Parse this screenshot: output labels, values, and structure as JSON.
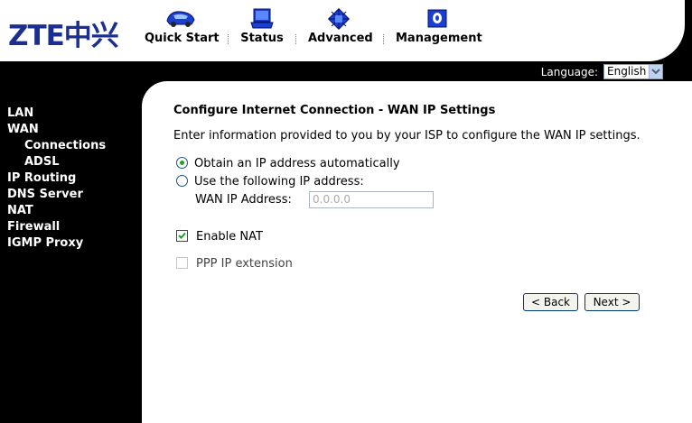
{
  "brand": {
    "logo": "ZTE中兴",
    "color": "#1a2f8f"
  },
  "nav": [
    {
      "label": "Quick Start",
      "icon": "car-icon"
    },
    {
      "label": "Status",
      "icon": "laptop-icon"
    },
    {
      "label": "Advanced",
      "icon": "chip-icon"
    },
    {
      "label": "Management",
      "icon": "book-icon"
    }
  ],
  "language": {
    "label": "Language:",
    "value": "English"
  },
  "sidebar": [
    {
      "label": "LAN"
    },
    {
      "label": "WAN"
    },
    {
      "label": "Connections"
    },
    {
      "label": "ADSL"
    },
    {
      "label": "IP Routing"
    },
    {
      "label": "DNS Server"
    },
    {
      "label": "NAT"
    },
    {
      "label": "Firewall"
    },
    {
      "label": "IGMP Proxy"
    }
  ],
  "form": {
    "title": "Configure Internet Connection - WAN IP Settings",
    "description": "Enter information provided to you by your ISP to configure the WAN IP settings.",
    "radio_auto": "Obtain an IP address automatically",
    "radio_static": "Use the following IP address:",
    "wan_ip_label": "WAN IP Address:",
    "wan_ip_value": "0.0.0.0",
    "enable_nat": "Enable NAT",
    "ppp_ip_extension": "PPP IP extension",
    "back": "< Back",
    "next": "Next >"
  }
}
